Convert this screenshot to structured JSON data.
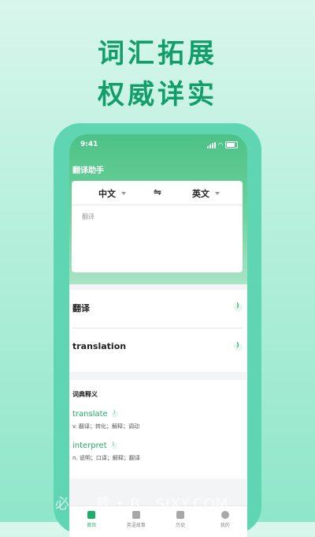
{
  "promo": {
    "line1": "词汇拓展",
    "line2": "权威详实"
  },
  "status_bar": {
    "time": "9:41"
  },
  "app": {
    "title": "翻译助手"
  },
  "translator": {
    "source_lang": "中文",
    "swap_symbol": "⇋",
    "target_lang": "英文",
    "input_placeholder": "翻译"
  },
  "result": {
    "source_text": "翻译",
    "translated_text": "translation"
  },
  "dictionary": {
    "title": "词典释义",
    "entries": [
      {
        "word": "translate",
        "definition": "v. 翻译；转化；解释；调动"
      },
      {
        "word": "interpret",
        "definition": "n. 说明；口译；解释；翻译"
      }
    ]
  },
  "tabs": [
    {
      "label": "首页",
      "active": true
    },
    {
      "label": "英语故事",
      "active": false
    },
    {
      "label": "历史",
      "active": false
    },
    {
      "label": "我的",
      "active": false
    }
  ],
  "watermark": "必 … 载 • B…SIXY.COM",
  "colors": {
    "accent": "#1fae68",
    "header": "#4cc287",
    "phone_frame": "#5fd6b1"
  }
}
